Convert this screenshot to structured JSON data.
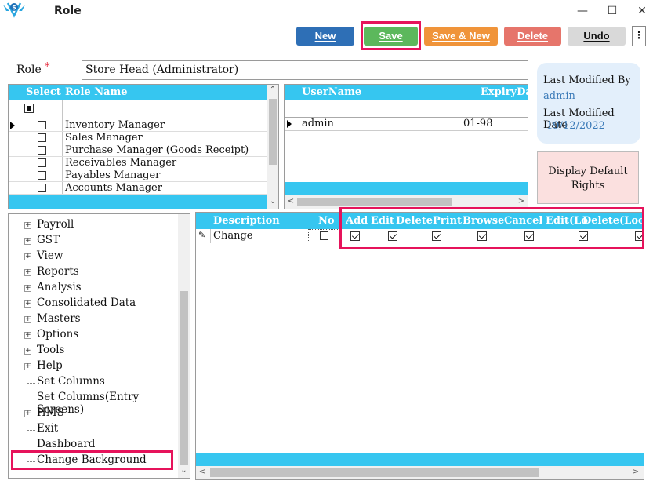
{
  "window": {
    "title": "Role",
    "minimize": "—",
    "maximize": "☐",
    "close": "✕"
  },
  "toolbar": {
    "new_label": "New",
    "save_label": "Save",
    "save_new_label": "Save & New",
    "delete_label": "Delete",
    "undo_label": "Undo",
    "more_icon": "⋮"
  },
  "role": {
    "label": "Role",
    "required_mark": "*",
    "value": "Store Head (Administrator)"
  },
  "roles_grid": {
    "headers": [
      "Select",
      "Role Name"
    ],
    "rows": [
      "Inventory Manager",
      "Sales Manager",
      "Purchase Manager (Goods Receipt)",
      "Receivables Manager",
      "Payables Manager",
      "Accounts Manager"
    ]
  },
  "users_grid": {
    "headers": [
      "UserName",
      "ExpiryDa"
    ],
    "rows": [
      {
        "username": "admin",
        "expiry": "01-98"
      }
    ]
  },
  "info": {
    "modified_by_label": "Last Modified By",
    "modified_by_value": "admin",
    "modified_date_label": "Last Modified Date",
    "modified_date_value": "19/12/2022"
  },
  "default_rights": {
    "line1": "Display Default",
    "line2": "Rights"
  },
  "tree": {
    "items": [
      {
        "label": "Payroll",
        "expandable": true
      },
      {
        "label": "GST",
        "expandable": true
      },
      {
        "label": "View",
        "expandable": true
      },
      {
        "label": "Reports",
        "expandable": true
      },
      {
        "label": "Analysis",
        "expandable": true
      },
      {
        "label": "Consolidated Data",
        "expandable": true
      },
      {
        "label": "Masters",
        "expandable": true
      },
      {
        "label": "Options",
        "expandable": true
      },
      {
        "label": "Tools",
        "expandable": true
      },
      {
        "label": "Help",
        "expandable": true
      },
      {
        "label": "Set Columns",
        "expandable": false
      },
      {
        "label": "Set Columns(Entry Screens)",
        "expandable": false
      },
      {
        "label": "HMS",
        "expandable": true
      },
      {
        "label": "Exit",
        "expandable": false
      },
      {
        "label": "Dashboard",
        "expandable": false
      },
      {
        "label": "Change Background",
        "expandable": false
      }
    ]
  },
  "rights_grid": {
    "headers": [
      "Description",
      "No",
      "Add",
      "Edit",
      "Delete",
      "Print",
      "Browse",
      "Cancel",
      "Edit(Lo",
      "Delete(Lockd"
    ],
    "rows": [
      {
        "description": "Change",
        "no": false,
        "add": true,
        "edit": true,
        "delete": true,
        "print": true,
        "browse": true,
        "cancel": true,
        "edit_lock": true,
        "delete_lock": true
      }
    ]
  },
  "colors": {
    "grid_header": "#36c6f0",
    "new": "#2e6fb6",
    "save": "#5cb85c",
    "save_new": "#f0943a",
    "delete": "#e6756b",
    "undo": "#d9d9d9",
    "highlight": "#e6135b"
  }
}
